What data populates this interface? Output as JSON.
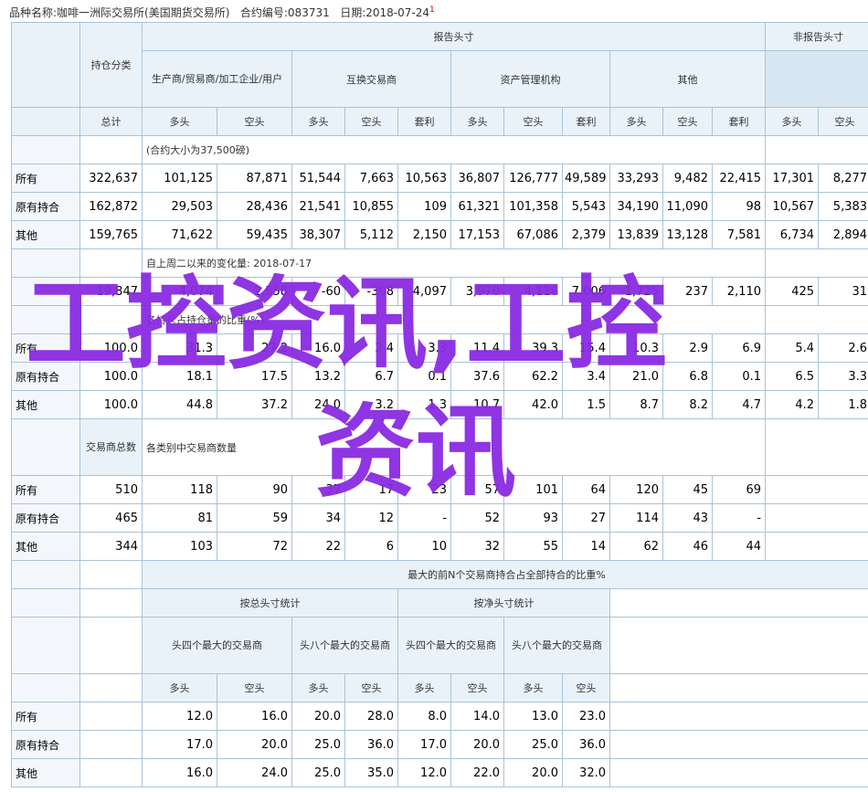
{
  "header": {
    "product": "品种名称:咖啡一洲际交易所(美国期货交易所)",
    "contract": "合约编号:083731",
    "date": "日期:2018-07-24",
    "mark": "1"
  },
  "top": {
    "reportable": "报告头寸",
    "nonreportable": "非报告头寸",
    "holding_class": "持仓分类",
    "producer": "生产商/贸易商/加工企业/用户",
    "swap": "互换交易商",
    "managed": "资产管理机构",
    "other": "其他",
    "total": "总计",
    "long": "多头",
    "short": "空头",
    "spread": "套利"
  },
  "s1": {
    "note": "(合约大小为37,500磅)",
    "rows": [
      {
        "label": "所有",
        "vals": [
          "322,637",
          "101,125",
          "87,871",
          "51,544",
          "7,663",
          "10,563",
          "36,807",
          "126,777",
          "49,589",
          "33,293",
          "9,482",
          "22,415",
          "17,301",
          "8,277"
        ]
      },
      {
        "label": "原有持合",
        "vals": [
          "162,872",
          "29,503",
          "28,436",
          "21,541",
          "10,855",
          "109",
          "61,321",
          "101,358",
          "5,543",
          "34,190",
          "11,090",
          "98",
          "10,567",
          "5,383"
        ]
      },
      {
        "label": "其他",
        "vals": [
          "159,765",
          "71,622",
          "59,435",
          "38,307",
          "5,112",
          "2,150",
          "17,153",
          "67,086",
          "2,379",
          "13,839",
          "13,128",
          "7,581",
          "6,734",
          "2,894"
        ]
      }
    ]
  },
  "s2": {
    "note": "自上周二以来的变化量: 2018-07-17",
    "vals": [
      "19,847",
      "4,074",
      "2,558",
      "-60",
      "-308",
      "4,097",
      "3,970",
      "4,116",
      "7,006",
      "-1,725",
      "237",
      "2,110",
      "425",
      "31"
    ]
  },
  "s3": {
    "note": "各持仓占持仓量的比重(%)",
    "rows": [
      {
        "label": "所有",
        "vals": [
          "100.0",
          "31.3",
          "27.2",
          "16.0",
          "2.4",
          "3.3",
          "11.4",
          "39.3",
          "15.4",
          "10.3",
          "2.9",
          "6.9",
          "5.4",
          "2.6"
        ]
      },
      {
        "label": "原有持合",
        "vals": [
          "100.0",
          "18.1",
          "17.5",
          "13.2",
          "6.7",
          "0.1",
          "37.6",
          "62.2",
          "3.4",
          "21.0",
          "6.8",
          "0.1",
          "6.5",
          "3.3"
        ]
      },
      {
        "label": "其他",
        "vals": [
          "100.0",
          "44.8",
          "37.2",
          "24.0",
          "3.2",
          "1.3",
          "10.7",
          "42.0",
          "1.5",
          "8.7",
          "8.2",
          "4.7",
          "4.2",
          "1.8"
        ]
      }
    ]
  },
  "s4": {
    "total_traders": "交易商总数",
    "note": "各类别中交易商数量",
    "rows": [
      {
        "label": "所有",
        "vals": [
          "510",
          "118",
          "90",
          "37",
          "17",
          "23",
          "57",
          "101",
          "64",
          "120",
          "45",
          "69"
        ]
      },
      {
        "label": "原有持合",
        "vals": [
          "465",
          "81",
          "59",
          "34",
          "12",
          "-",
          "52",
          "93",
          "27",
          "114",
          "43",
          "-"
        ]
      },
      {
        "label": "其他",
        "vals": [
          "344",
          "103",
          "72",
          "22",
          "6",
          "10",
          "32",
          "55",
          "14",
          "62",
          "46",
          "44"
        ]
      }
    ]
  },
  "s5": {
    "title": "最大的前N个交易商持合占全部持合的比重%",
    "gross": "按总头寸统计",
    "net": "按净头寸统计",
    "top4": "头四个最大的交易商",
    "top8": "头八个最大的交易商",
    "long": "多头",
    "short": "空头",
    "rows": [
      {
        "label": "所有",
        "vals": [
          "12.0",
          "16.0",
          "20.0",
          "28.0",
          "8.0",
          "14.0",
          "13.0",
          "23.0"
        ]
      },
      {
        "label": "原有持合",
        "vals": [
          "17.0",
          "20.0",
          "25.0",
          "36.0",
          "17.0",
          "20.0",
          "25.0",
          "36.0"
        ]
      },
      {
        "label": "其他",
        "vals": [
          "16.0",
          "24.0",
          "25.0",
          "35.0",
          "12.0",
          "22.0",
          "20.0",
          "32.0"
        ]
      }
    ]
  },
  "watermark": {
    "line1": "工控资讯,工控",
    "line2": "资讯",
    "color": "#8a2be2"
  },
  "colors": {
    "border": "#a9c3d8",
    "header_bg": "#e9f2f9",
    "header_dark": "#d8e6f1"
  }
}
